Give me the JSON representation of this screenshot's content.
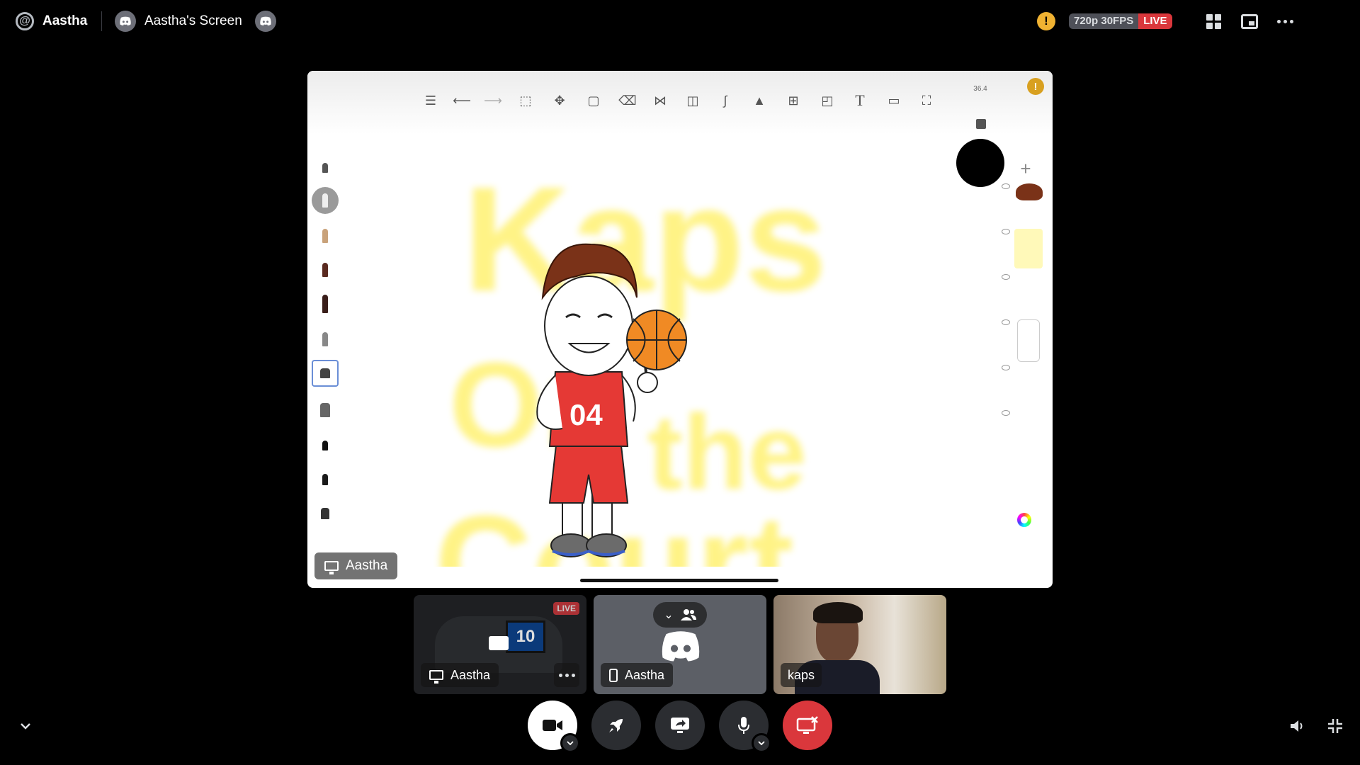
{
  "topbar": {
    "user_name": "Aastha",
    "screen_title": "Aastha's Screen",
    "quality": "720p 30FPS",
    "live": "LIVE"
  },
  "stream": {
    "app": {
      "zoom_readout": "36.4",
      "tools": [
        "gallery-icon",
        "undo-icon",
        "redo-icon",
        "selection-icon",
        "transform-icon",
        "layer-copy-icon",
        "eraser-icon",
        "symmetry-icon",
        "shape-icon",
        "curve-icon",
        "image-insert-icon",
        "perspective-grid-icon",
        "liquify-icon",
        "text-icon",
        "video-icon",
        "fullscreen-icon"
      ],
      "canvas_text": [
        "Kaps",
        "On",
        "the",
        "Court"
      ],
      "jersey_number": "04",
      "brush_color": "#000000"
    },
    "owner_label": "Aastha"
  },
  "tiles": [
    {
      "name": "Aastha",
      "badge": "LIVE",
      "tile_number": "10",
      "kind": "screen"
    },
    {
      "name": "Aastha",
      "kind": "mobile"
    },
    {
      "name": "kaps",
      "kind": "camera"
    }
  ],
  "colors": {
    "live_red": "#da373c",
    "control_dark": "#2b2d31",
    "warning_yellow": "#f0b232"
  }
}
